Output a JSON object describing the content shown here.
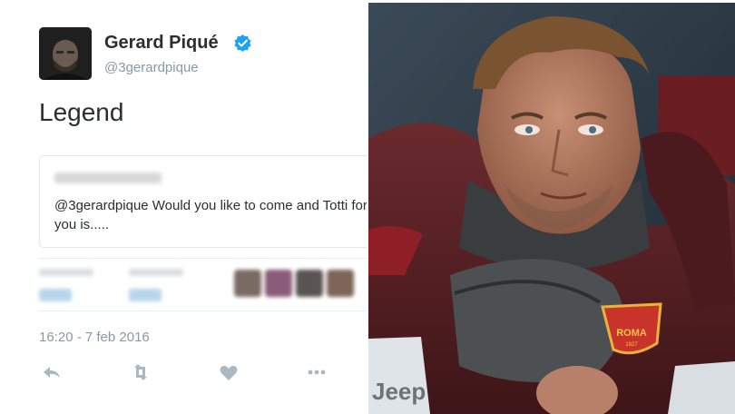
{
  "tweet": {
    "author_name": "Gerard Piqué",
    "author_handle": "@3gerardpique",
    "text": "Legend",
    "quoted_text": "@3gerardpique Would you like to come and Totti for you is.....",
    "timestamp": "16:20 - 7 feb 2016",
    "verified_color": "#1da1f2",
    "icons": [
      "reply-icon",
      "retweet-icon",
      "like-icon",
      "more-icon"
    ]
  },
  "photo": {
    "badge_text": "ROMA",
    "badge_year": "1927",
    "seat_text": "Jeep"
  }
}
